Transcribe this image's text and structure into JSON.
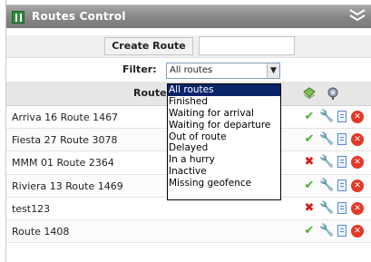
{
  "window": {
    "title": "Routes Control"
  },
  "create": {
    "button_label": "Create Route",
    "input_value": ""
  },
  "filter": {
    "label": "Filter:",
    "selected": "All routes",
    "options": [
      "All routes",
      "Finished",
      "Waiting for arrival",
      "Waiting for departure",
      "Out of route",
      "Delayed",
      "In a hurry",
      "Inactive",
      "Missing geofence"
    ]
  },
  "table": {
    "header_route_label": "Route",
    "rows": [
      {
        "name": "Arriva 16 Route 1467",
        "status": "check"
      },
      {
        "name": "Fiesta 27 Route 3078",
        "status": "check"
      },
      {
        "name": "MMM 01 Route 2364",
        "status": "cross"
      },
      {
        "name": "Riviera 13 Route 1469",
        "status": "check"
      },
      {
        "name": "test123",
        "status": "cross"
      },
      {
        "name": "Route 1408",
        "status": "check"
      }
    ]
  },
  "icons": {
    "title": "routes-icon",
    "collapse": "double-chevron-down-icon",
    "header_col1": "map-icon",
    "header_col2": "gear-icon",
    "edit": "wrench-icon",
    "doc": "document-icon",
    "delete": "delete-icon"
  },
  "colors": {
    "titlebar": "#858585",
    "selected_option": "#0a246a",
    "check": "#4caf2a",
    "cross": "#d81b1b"
  }
}
